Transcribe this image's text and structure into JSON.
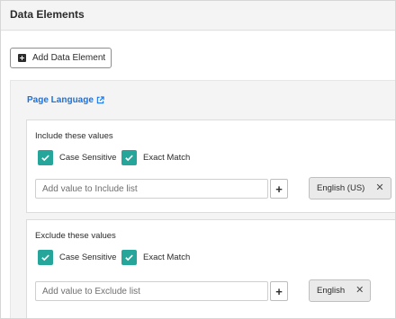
{
  "header": {
    "title": "Data Elements"
  },
  "toolbar": {
    "add_label": "Add Data Element"
  },
  "panel": {
    "link_label": "Page Language"
  },
  "include": {
    "title": "Include these values",
    "case_sensitive_label": "Case Sensitive",
    "exact_match_label": "Exact Match",
    "case_sensitive_checked": true,
    "exact_match_checked": true,
    "input_placeholder": "Add value to Include list",
    "input_value": "",
    "tags": [
      "English (US)"
    ]
  },
  "exclude": {
    "title": "Exclude these values",
    "case_sensitive_label": "Case Sensitive",
    "exact_match_label": "Exact Match",
    "case_sensitive_checked": true,
    "exact_match_checked": true,
    "input_placeholder": "Add value to Exclude list",
    "input_value": "",
    "tags": [
      "English"
    ]
  },
  "colors": {
    "accent": "#26a69a",
    "link": "#1473e6"
  },
  "icons": [
    "plus-square-icon",
    "external-link-icon",
    "checkmark-icon",
    "plus-icon",
    "close-icon"
  ]
}
